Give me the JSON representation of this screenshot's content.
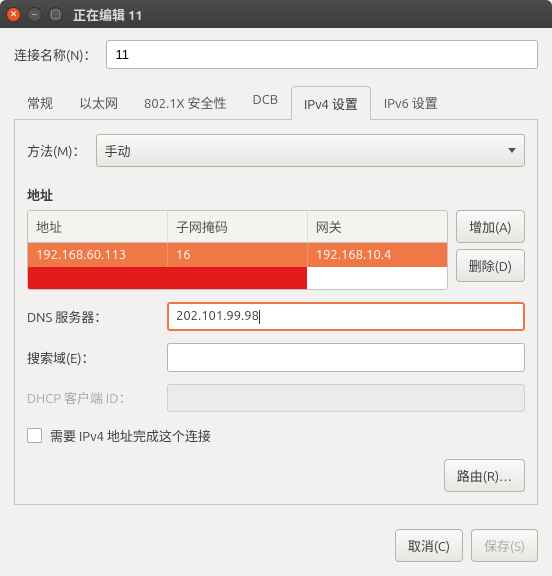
{
  "titlebar": {
    "title": "正在编辑 11"
  },
  "connection": {
    "label": "连接名称(N)：",
    "value": "11"
  },
  "tabs": [
    "常规",
    "以太网",
    "802.1X 安全性",
    "DCB",
    "IPv4 设置",
    "IPv6 设置"
  ],
  "active_tab": 4,
  "ipv4": {
    "method_label": "方法(M)：",
    "method_value": "手动",
    "addr_section": "地址",
    "columns": [
      "地址",
      "子网掩码",
      "网关"
    ],
    "row": {
      "addr": "192.168.60.113",
      "mask": "16",
      "gw": "192.168.10.4"
    },
    "add_btn": "增加(A)",
    "del_btn": "删除(D)",
    "dns_label": "DNS 服务器：",
    "dns_value": "202.101.99.98",
    "search_label": "搜索域(E)：",
    "search_value": "",
    "dhcp_label": "DHCP 客户端 ID：",
    "require_label": "需要 IPv4 地址完成这个连接",
    "route_btn": "路由(R)…"
  },
  "footer": {
    "cancel": "取消(C)",
    "save": "保存(S)"
  }
}
